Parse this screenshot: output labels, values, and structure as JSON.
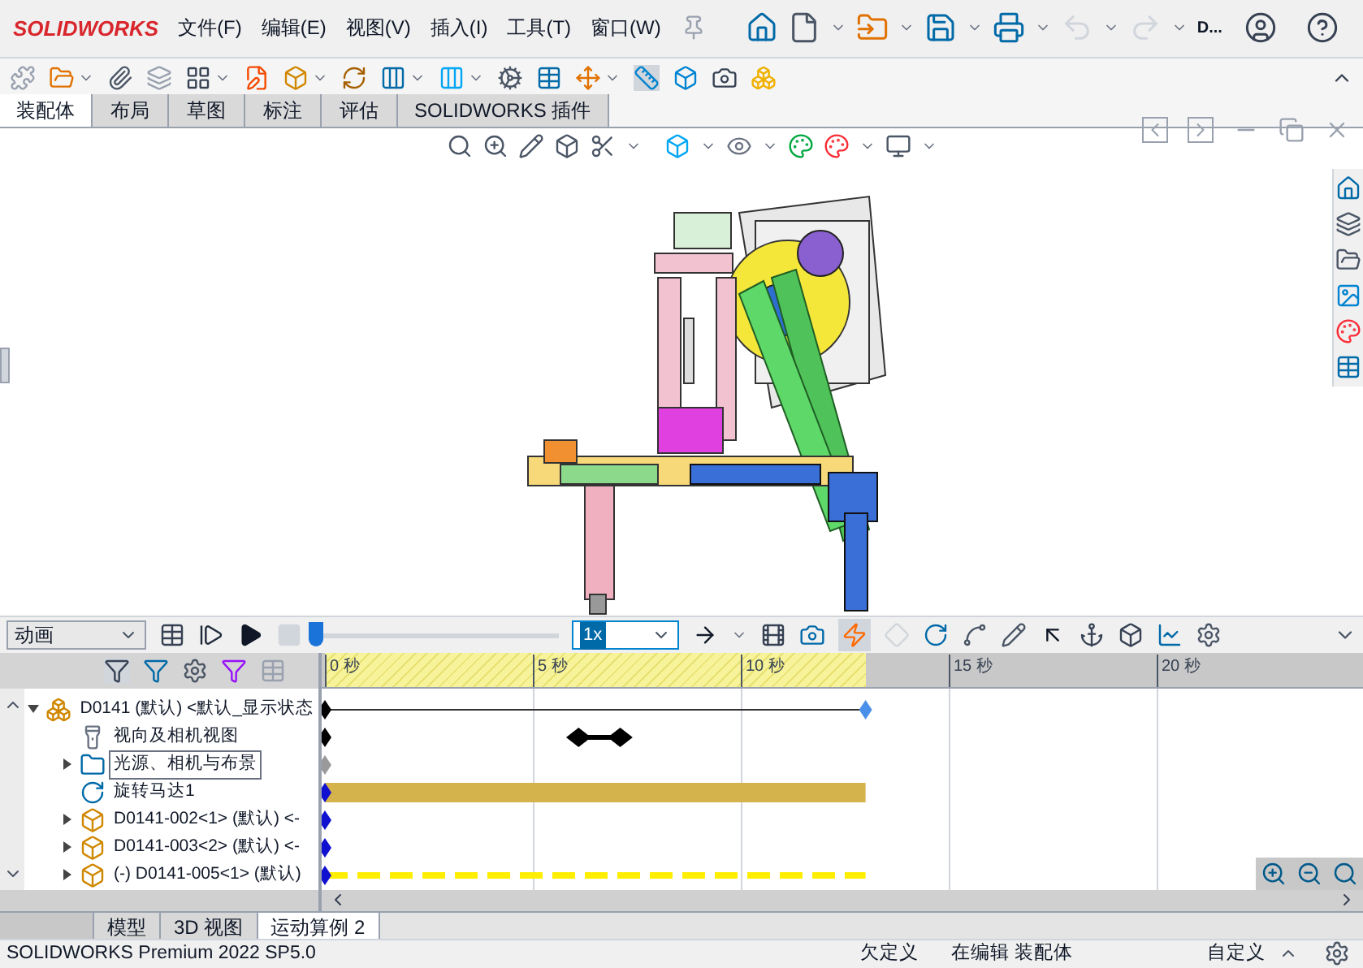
{
  "app": {
    "logo": "SOLIDWORKS"
  },
  "menu": [
    "文件(F)",
    "编辑(E)",
    "视图(V)",
    "插入(I)",
    "工具(T)",
    "窗口(W)"
  ],
  "quick_access": {
    "document_label": "D..."
  },
  "command_tabs": [
    {
      "label": "装配体",
      "selected": true
    },
    {
      "label": "布局",
      "selected": false
    },
    {
      "label": "草图",
      "selected": false
    },
    {
      "label": "标注",
      "selected": false
    },
    {
      "label": "评估",
      "selected": false
    },
    {
      "label": "SOLIDWORKS 插件",
      "selected": false
    }
  ],
  "motion_toolbar": {
    "study_type": "动画",
    "level": 0.0,
    "speed": "1x"
  },
  "timeline": {
    "ticks": [
      "0 秒",
      "5 秒",
      "10 秒",
      "15 秒",
      "20 秒"
    ],
    "tracks": [
      {
        "kind": "line",
        "color": "#000000"
      },
      {
        "kind": "marker",
        "color": "#000000"
      },
      {
        "kind": "keys",
        "color": "#9a9a9a"
      },
      {
        "kind": "bar",
        "color": "#1010d0"
      },
      {
        "kind": "keys",
        "color": "#1010d0"
      },
      {
        "kind": "keys",
        "color": "#1010d0"
      },
      {
        "kind": "dashed",
        "color": "#1010d0"
      }
    ]
  },
  "tree": {
    "rows": [
      {
        "label": "D0141 (默认) <默认_显示状态",
        "kind": "assembly",
        "expanded": true,
        "selected": false
      },
      {
        "label": "视向及相机视图",
        "kind": "camera",
        "selected": false
      },
      {
        "label": "光源、相机与布景",
        "kind": "folder",
        "expanded": false,
        "selected": true
      },
      {
        "label": "旋转马达1",
        "kind": "motor",
        "selected": false
      },
      {
        "label": "D0141-002<1> (默认) <-",
        "kind": "part",
        "expanded": false,
        "selected": false
      },
      {
        "label": "D0141-003<2> (默认) <-",
        "kind": "part",
        "expanded": false,
        "selected": false
      },
      {
        "label": "(-) D0141-005<1> (默认)",
        "kind": "part",
        "expanded": false,
        "selected": false
      }
    ]
  },
  "study_tabs": [
    {
      "label": "模型",
      "selected": false
    },
    {
      "label": "3D 视图",
      "selected": false
    },
    {
      "label": "运动算例 2",
      "selected": true
    }
  ],
  "status_bar": {
    "product": "SOLIDWORKS Premium 2022 SP5.0",
    "state": "欠定义",
    "mode": "在编辑 装配体",
    "units": "自定义"
  }
}
